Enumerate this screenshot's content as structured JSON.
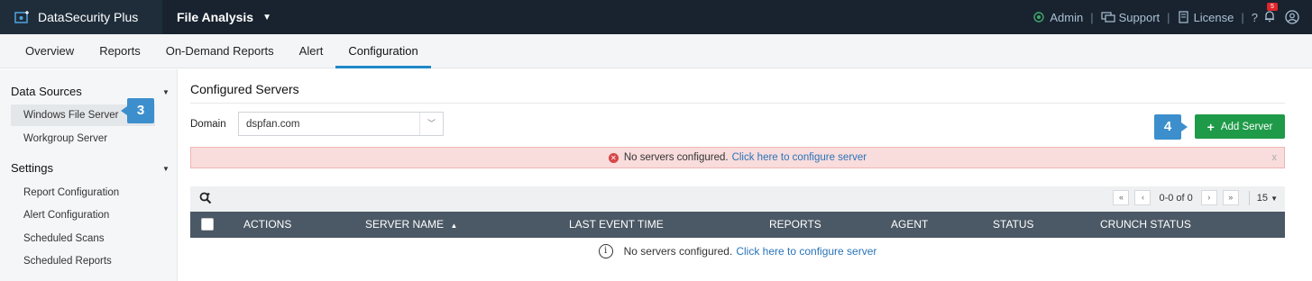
{
  "header": {
    "brand": "DataSecurity Plus",
    "module": "File Analysis",
    "links": {
      "admin": "Admin",
      "support": "Support",
      "license": "License",
      "help": "?",
      "separator": "|"
    },
    "notification_count": "5"
  },
  "tabs": [
    "Overview",
    "Reports",
    "On-Demand Reports",
    "Alert",
    "Configuration"
  ],
  "active_tab": "Configuration",
  "sidebar": {
    "data_sources": {
      "title": "Data Sources",
      "items": [
        "Windows File Server",
        "Workgroup Server"
      ]
    },
    "settings": {
      "title": "Settings",
      "items": [
        "Report Configuration",
        "Alert Configuration",
        "Scheduled Scans",
        "Scheduled Reports"
      ]
    }
  },
  "steps": {
    "step3": "3",
    "step4": "4"
  },
  "main": {
    "title": "Configured Servers",
    "domain_label": "Domain",
    "domain_value": "dspfan.com",
    "add_server": "Add Server",
    "alert_text": "No servers configured.",
    "alert_link": "Click here to configure server",
    "alert_close": "x",
    "pager": {
      "range": "0-0 of 0",
      "page_size": "15"
    },
    "columns": [
      "ACTIONS",
      "SERVER NAME",
      "LAST EVENT TIME",
      "REPORTS",
      "AGENT",
      "STATUS",
      "CRUNCH STATUS"
    ],
    "empty_text": "No servers configured.",
    "empty_link": "Click here to configure server"
  },
  "colors": {
    "topbar": "#18232f",
    "accent": "#1e88c7",
    "add_button": "#1e9a48",
    "step_badge": "#3c8fcc",
    "alert_bg": "#f9dcdc",
    "table_header": "#4b5865"
  }
}
